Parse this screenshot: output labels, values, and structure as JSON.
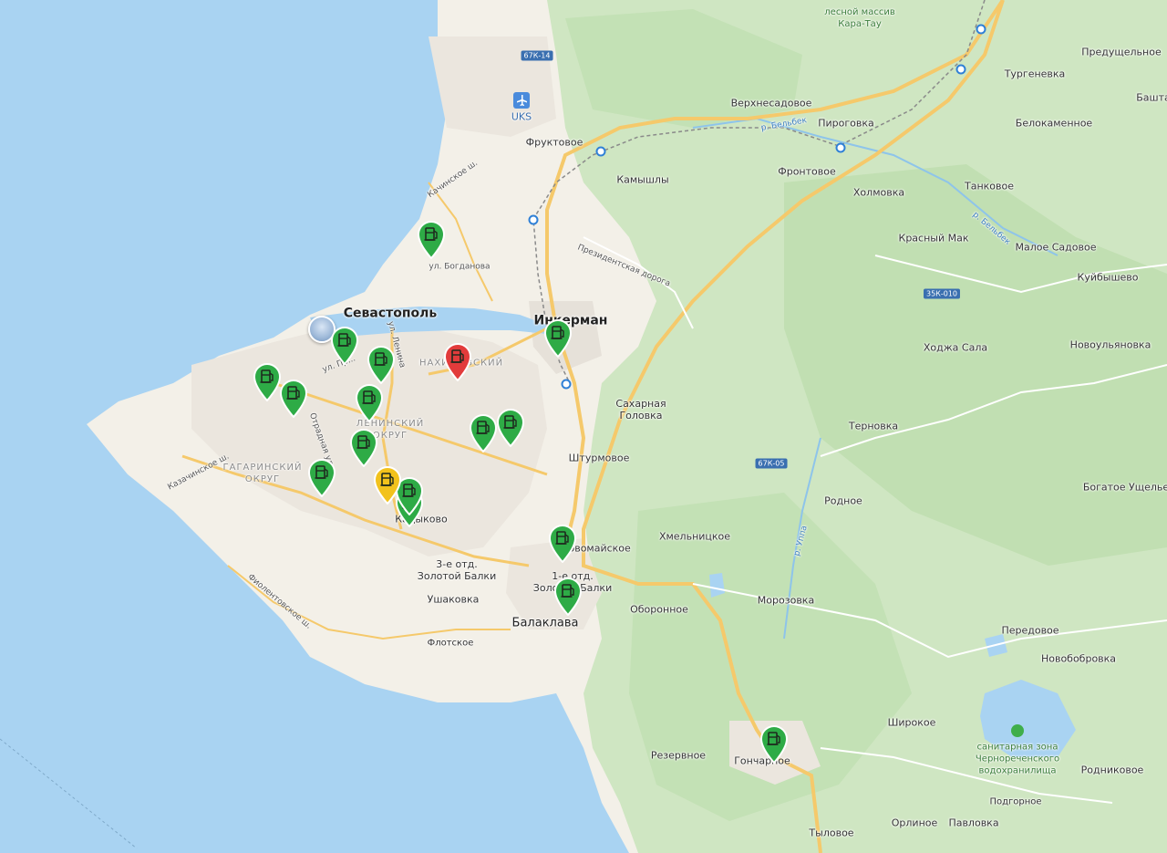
{
  "map": {
    "colors": {
      "sea": "#a9d3f2",
      "land": "#f3f0e8",
      "forest": "#cfe6c2",
      "forest_dark": "#b8dba7",
      "urban": "#ebe6de",
      "road_major": "#f5c96b",
      "road_minor": "#ffffff",
      "pin_green": "#2eab46",
      "pin_red": "#e23b3b",
      "pin_yellow": "#f2c21c"
    },
    "labels": {
      "sevastopol": "Севастополь",
      "inkerman": "Инкерман",
      "balaklava": "Балаклава",
      "uks": "UKS",
      "fruktovoe": "Фруктовое",
      "kamyshly": "Камышлы",
      "verkhnesadovoe": "Верхнесадовое",
      "pirogovka": "Пироговка",
      "frontovoe": "Фронтовое",
      "kholmovka": "Холмовка",
      "turgenevka": "Тургеневка",
      "predushchelnoe": "Предущельное",
      "bashta": "Башта",
      "belokamennoe": "Белокаменное",
      "tankovoe": "Танковое",
      "krasny_mak": "Красный Мак",
      "maloe_sadovoe": "Малое Садовое",
      "kuibyshevo": "Куйбышево",
      "khodzha_sala": "Ходжа Сала",
      "novoulyanovka": "Новоульяновка",
      "sakharnaya_golovka": "Сахарная\nГоловка",
      "ternovka": "Терновка",
      "shturmovoe": "Штурмовое",
      "rodnoe": "Родное",
      "bogatoe_ushchelie": "Богатое Ущелье",
      "khmelnitskoe": "Хмельницкое",
      "pervomayskoe": "Первомайское",
      "oboronnoe": "Оборонное",
      "morozovka": "Морозовка",
      "peredovoe": "Передовое",
      "novobobrovka": "Новобобровка",
      "shirokoe": "Широкое",
      "rodnikovoe": "Родниковое",
      "podgornoe": "Подгорное",
      "orlinoe": "Орлиное",
      "pavlovka": "Павловка",
      "tylovoe": "Тыловое",
      "goncharnoe": "Гончарное",
      "rezervnoe": "Резервное",
      "flotskoe": "Флотское",
      "ushakovka": "Ушаковка",
      "zolotaya_balka_3": "3-е отд.\nЗолотой Балки",
      "zolotaya_balka_1": "1-е отд.\nЗолотой Балки",
      "kadykovo": "Кадыково",
      "nakhimovsky": "НАХИМОВСКИЙ",
      "leninsky": "ЛЕНИНСКИЙ\nОКРУГ",
      "gagarinsky": "ГАГАРИНСКИЙ\nОКРУГ",
      "les_kara_tau": "лесной массив\nКара-Тау",
      "reserve_chernorechensk": "санитарная зона\nЧернореченского\nводохранилища",
      "ul_bogdanova": "ул. Богданова",
      "kachinskoe_sh": "Качинское ш.",
      "prezidentskaya": "Президентская дорога",
      "kazachinskoe_sh": "Казачинское ш.",
      "fiolentovskoe_sh": "Фиолентовское ш.",
      "ul_pr": "ул. Пр...",
      "ul_lenina": "ул. Ленина",
      "otradnaya_ul": "Отрадная ул.",
      "r_belbek_1": "р. Бельбек",
      "r_belbek_2": "р. Бельбек",
      "r_uppa": "р. Уппа",
      "road_67k14": "67К-14",
      "road_35k010": "35К-010",
      "road_67k05": "67К-05"
    },
    "pins": [
      {
        "type": "green",
        "icon": "fuel-station-icon"
      },
      {
        "type": "green",
        "icon": "fuel-station-icon"
      },
      {
        "type": "green",
        "icon": "fuel-station-icon"
      },
      {
        "type": "green",
        "icon": "fuel-station-icon"
      },
      {
        "type": "green",
        "icon": "fuel-station-icon"
      },
      {
        "type": "green",
        "icon": "fuel-station-icon"
      },
      {
        "type": "green",
        "icon": "fuel-station-icon"
      },
      {
        "type": "green",
        "icon": "fuel-station-icon"
      },
      {
        "type": "green",
        "icon": "fuel-station-icon"
      },
      {
        "type": "green",
        "icon": "fuel-station-icon"
      },
      {
        "type": "green",
        "icon": "fuel-station-icon"
      },
      {
        "type": "green",
        "icon": "fuel-station-icon"
      },
      {
        "type": "green",
        "icon": "fuel-station-icon"
      },
      {
        "type": "green",
        "icon": "fuel-station-icon"
      },
      {
        "type": "green",
        "icon": "fuel-station-icon"
      },
      {
        "type": "green",
        "icon": "fuel-station-icon"
      },
      {
        "type": "red",
        "icon": "fuel-station-icon"
      },
      {
        "type": "yellow",
        "icon": "fuel-station-icon"
      }
    ]
  }
}
